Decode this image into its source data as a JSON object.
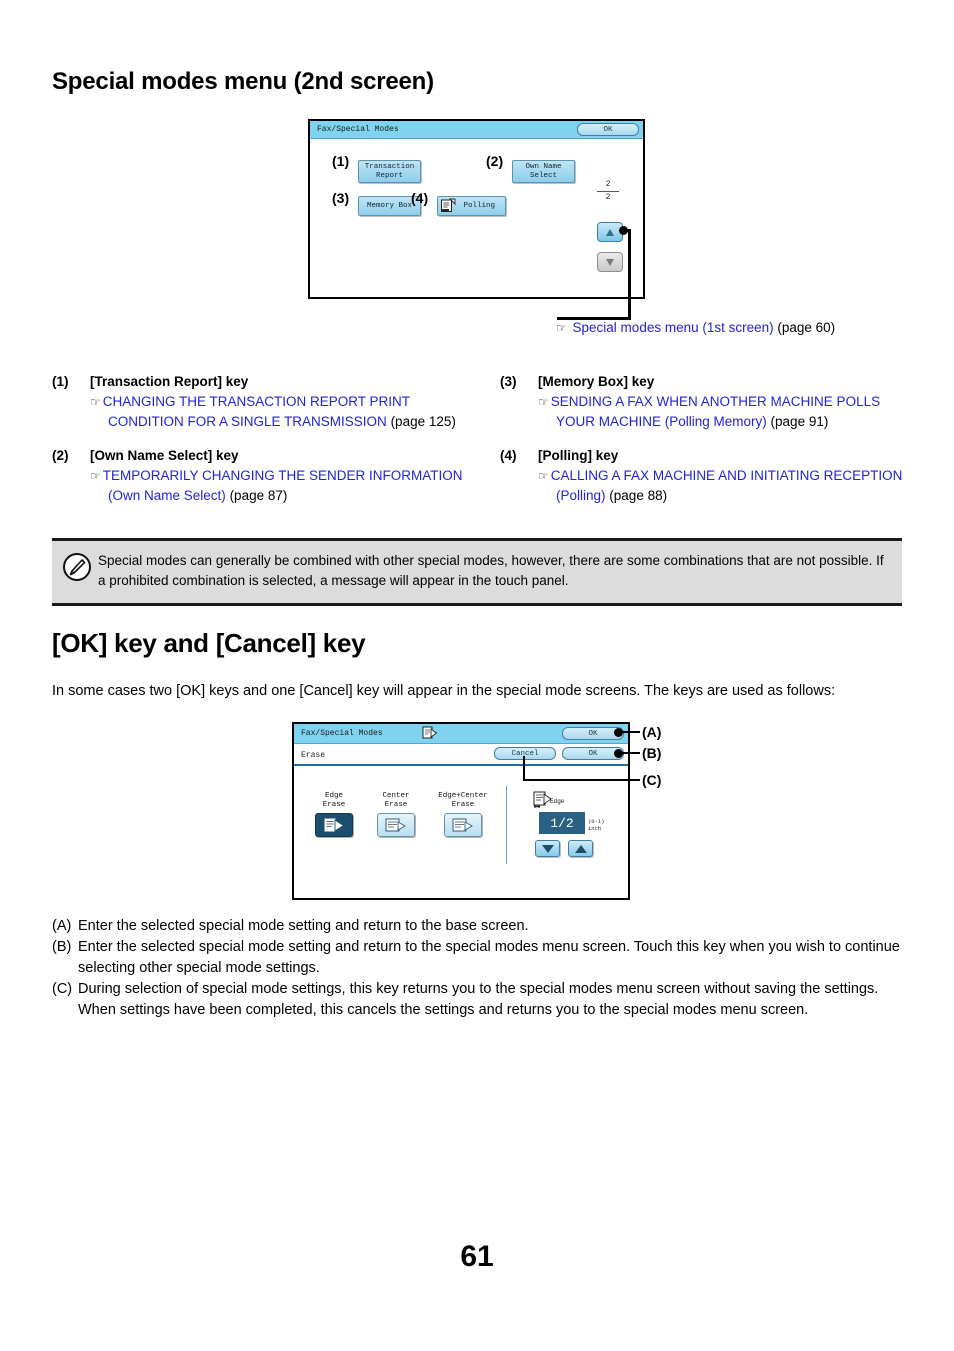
{
  "page": {
    "number": "61"
  },
  "section1": {
    "title": "Special modes menu (2nd screen)",
    "reference": {
      "hand_icon": "pointing-hand-icon",
      "link_text": "Special modes menu (1st screen)",
      "page_text": "(page 60)"
    }
  },
  "screen1": {
    "titlebar": {
      "title": "Fax/Special Modes",
      "ok_label": "OK"
    },
    "keys": [
      {
        "callout": "(1)",
        "label": "Transaction\nReport",
        "line1": "Transaction",
        "line2": "Report"
      },
      {
        "callout": "(2)",
        "label": "Own Name\nSelect",
        "line1": "Own Name",
        "line2": "Select"
      },
      {
        "callout": "(3)",
        "label": "Memory Box",
        "line1": "Memory Box",
        "line2": ""
      },
      {
        "callout": "(4)",
        "label": "Polling",
        "line1": "Polling",
        "line2": "",
        "icon": "polling-icon"
      }
    ],
    "pager": {
      "current": "2",
      "total": "2"
    },
    "scroll_up_icon": "arrow-up-icon",
    "scroll_down_icon": "arrow-down-icon"
  },
  "keylist": [
    {
      "num": "(1)",
      "title": "[Transaction Report] key",
      "link": "CHANGING THE TRANSACTION REPORT PRINT CONDITION FOR A SINGLE TRANSMISSION",
      "page": "(page 125)"
    },
    {
      "num": "(2)",
      "title": "[Own Name Select] key",
      "link": "TEMPORARILY CHANGING THE SENDER INFORMATION (Own Name Select)",
      "page": "(page 87)"
    },
    {
      "num": "(3)",
      "title": "[Memory Box] key",
      "link": "SENDING A FAX WHEN ANOTHER MACHINE POLLS YOUR MACHINE (Polling Memory)",
      "page": "(page 91)"
    },
    {
      "num": "(4)",
      "title": "[Polling] key",
      "link": "CALLING A FAX MACHINE AND INITIATING RECEPTION (Polling)",
      "page": "(page 88)"
    }
  ],
  "note": {
    "icon": "note-pencil-icon",
    "text": "Special modes can generally be combined with other special modes, however, there are some combinations that are not possible. If a prohibited combination is selected, a message will appear in the touch panel."
  },
  "section2": {
    "title": "[OK] key and [Cancel] key",
    "intro": "In some cases two [OK] keys and one [Cancel] key will appear in the special mode screens. The keys are used as follows:"
  },
  "screen2": {
    "titlebar": {
      "title": "Fax/Special Modes",
      "ok_label": "OK",
      "doc_icon": "document-icon"
    },
    "subbar": {
      "title": "Erase",
      "cancel_label": "Cancel",
      "ok_label": "OK"
    },
    "erase_options": [
      {
        "line1": "Edge",
        "line2": "Erase",
        "selected": true,
        "icon": "edge-erase-icon"
      },
      {
        "line1": "Center",
        "line2": "Erase",
        "selected": false,
        "icon": "center-erase-icon"
      },
      {
        "line1": "Edge+Center",
        "line2": "Erase",
        "selected": false,
        "icon": "edge-center-erase-icon"
      }
    ],
    "edge_setting": {
      "icon": "edge-width-icon",
      "label": "Edge",
      "value": "1/2",
      "range": "(0-1)",
      "unit": "inch",
      "decrease_icon": "arrow-down-icon",
      "increase_icon": "arrow-up-icon"
    },
    "callouts": [
      {
        "tag": "(A)"
      },
      {
        "tag": "(B)"
      },
      {
        "tag": "(C)"
      }
    ]
  },
  "abc_list": [
    {
      "tag": "(A)",
      "text": "Enter the selected special mode setting and return to the base screen."
    },
    {
      "tag": "(B)",
      "text": "Enter the selected special mode setting and return to the special modes menu screen. Touch this key when you wish to continue selecting other special mode settings."
    },
    {
      "tag": "(C)",
      "text": "During selection of special mode settings, this key returns you to the special modes menu screen without saving the settings. When settings have been completed, this cancels the settings and returns you to the special modes menu screen."
    }
  ]
}
